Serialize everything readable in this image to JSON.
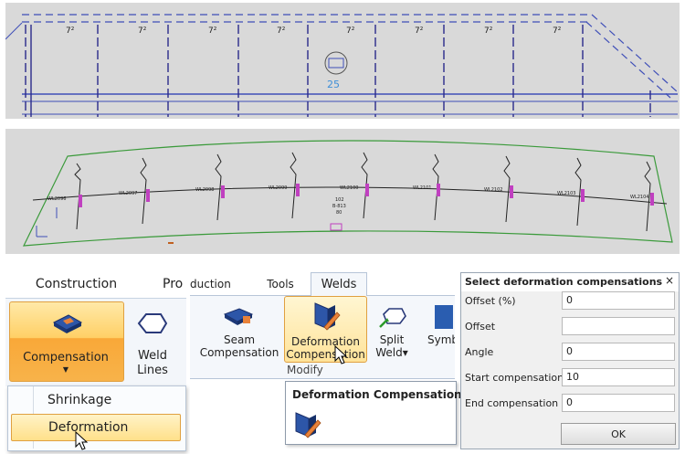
{
  "cad_top": {
    "weld_markers": [
      "7²",
      "7²",
      "7²",
      "7²",
      "7²",
      "7²",
      "7²",
      "7²"
    ],
    "section_marker": "25"
  },
  "cad_mid": {
    "weld_labels": [
      "WL2096",
      "WL2097",
      "WL2098",
      "WL2099",
      "WL2100",
      "WL2101",
      "WL2102",
      "WL2103",
      "WL2104"
    ],
    "center_text": [
      "102",
      "B-813",
      "80"
    ]
  },
  "left_ribbon": {
    "tab_construction": "Construction",
    "tab_production_partial": "Pro",
    "compensation_label": "Compensation",
    "weld_lines_label_1": "Weld",
    "weld_lines_label_2": "Lines",
    "menu": {
      "shrinkage": "Shrinkage",
      "deformation": "Deformation"
    }
  },
  "mid_ribbon": {
    "tab_production_partial": "duction",
    "tab_tools": "Tools",
    "tab_welds": "Welds",
    "seam_label_1": "Seam",
    "seam_label_2": "Compensation",
    "deform_label_1": "Deformation",
    "deform_label_2": "Compensation",
    "split_label_1": "Split",
    "split_label_2": "Weld▾",
    "symb_label": "Symb",
    "group_label": "Modify",
    "tooltip_title": "Deformation Compensation"
  },
  "dialog": {
    "title": "Select deformation compensations",
    "close": "×",
    "fields": [
      {
        "label": "Offset (%)",
        "value": "0"
      },
      {
        "label": "Offset",
        "value": ""
      },
      {
        "label": "Angle",
        "value": "0"
      },
      {
        "label": "Start compensation",
        "value": "10"
      },
      {
        "label": "End compensation",
        "value": "0"
      }
    ],
    "ok_label": "OK"
  }
}
